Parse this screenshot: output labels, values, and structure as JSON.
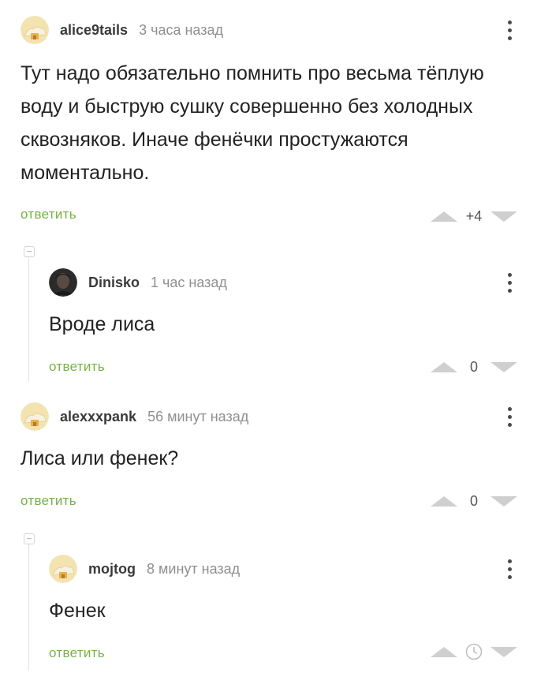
{
  "comments": [
    {
      "author": "alice9tails",
      "time": "3 часа назад",
      "text": "Тут надо обязательно помнить про весьма тёплую воду и быструю сушку совершенно без холодных сквозняков. Иначе фенёчки простужаются моментально.",
      "reply_label": "ответить",
      "score": "+4",
      "avatar": "default-avatar-icon"
    },
    {
      "author": "Dinisko",
      "time": "1 час назад",
      "text": "Вроде лиса",
      "reply_label": "ответить",
      "score": "0",
      "avatar": "user-photo-avatar"
    },
    {
      "author": "alexxxpank",
      "time": "56 минут назад",
      "text": "Лиса или фенек?",
      "reply_label": "ответить",
      "score": "0",
      "avatar": "default-avatar-icon"
    },
    {
      "author": "mojtog",
      "time": "8 минут назад",
      "text": "Фенек",
      "reply_label": "ответить",
      "score": "",
      "score_icon": "clock-icon",
      "avatar": "default-avatar-icon"
    }
  ],
  "colors": {
    "reply_link": "#76b245",
    "vote_arrow": "#cfcfcf",
    "timestamp": "#8f8f8f",
    "avatar_bg": "#f5e6b8"
  }
}
